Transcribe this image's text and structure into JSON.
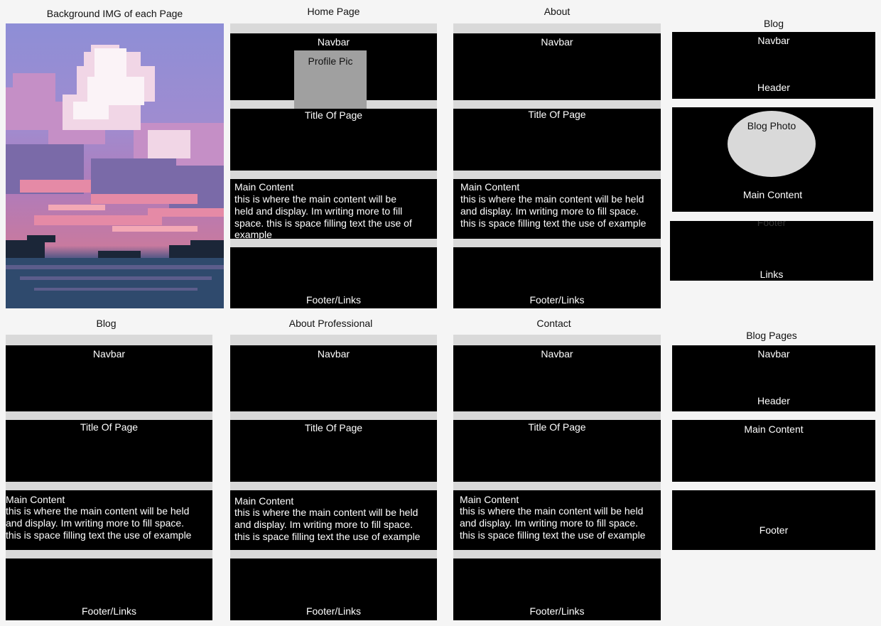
{
  "titles": {
    "background": "Background IMG of each Page",
    "home": "Home Page",
    "about": "About",
    "blog_top": "Blog",
    "blog": "Blog",
    "about_professional": "About Professional",
    "contact": "Contact",
    "blog_pages": "Blog Pages"
  },
  "labels": {
    "navbar": "Navbar",
    "profile_pic": "Profile Pic",
    "title_of_page": "Title Of Page",
    "main_content": "Main Content",
    "footer_links": "Footer/Links",
    "header": "Header",
    "blog_photo": "Blog Photo",
    "footer": "Footer",
    "links": "Links"
  },
  "main_text": {
    "line1": "this is where the main content will be held",
    "line2": "and display. Im writing more to fill space.",
    "line3": "this is space filling text the use of example",
    "home_line1": "this is where the main content will be",
    "home_line2": "held and display. Im writing more to fill",
    "home_line3": "space. this is space filling text the use of",
    "home_line4": "example"
  },
  "colors": {
    "canvas": "#f5f5f5",
    "frame": "#d9d9d9",
    "block": "#000000",
    "profile": "#a0a0a0",
    "blog_photo": "#d9d9d9"
  }
}
